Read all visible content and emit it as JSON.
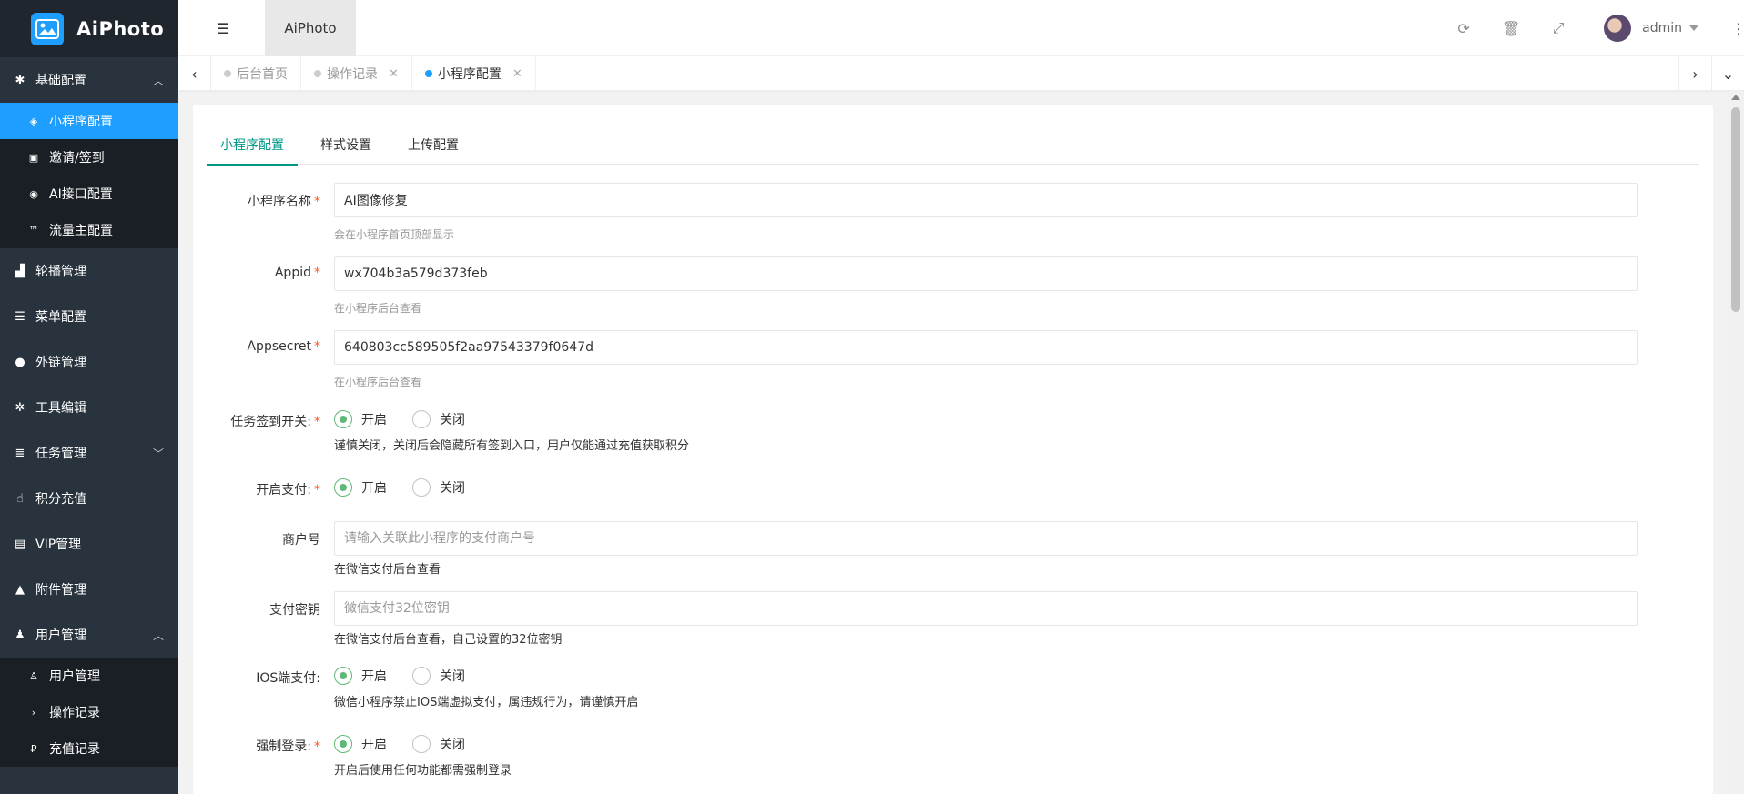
{
  "app": {
    "name": "AiPhoto",
    "header_tab": "AiPhoto"
  },
  "colors": {
    "accent": "#1e9fff",
    "tab_active": "#009688",
    "radio_checked": "#5fb878",
    "sidebar_bg": "#28333e"
  },
  "sidebar": {
    "groups": [
      {
        "label": "基础配置",
        "icon": "gear-icon",
        "expanded": true,
        "items": [
          {
            "label": "小程序配置",
            "icon": "eye-icon",
            "active": true
          },
          {
            "label": "邀请/签到",
            "icon": "contact-icon"
          },
          {
            "label": "AI接口配置",
            "icon": "chrome-icon"
          },
          {
            "label": "流量主配置",
            "icon": "trademark-icon"
          }
        ]
      },
      {
        "label": "轮播管理",
        "icon": "chart-icon"
      },
      {
        "label": "菜单配置",
        "icon": "menu-icon"
      },
      {
        "label": "外链管理",
        "icon": "android-icon"
      },
      {
        "label": "工具编辑",
        "icon": "cog-icon"
      },
      {
        "label": "任务管理",
        "icon": "list-icon",
        "collapsed_arrow": true
      },
      {
        "label": "积分充值",
        "icon": "hand-icon"
      },
      {
        "label": "VIP管理",
        "icon": "id-card-icon"
      },
      {
        "label": "附件管理",
        "icon": "upload-arrow-icon"
      },
      {
        "label": "用户管理",
        "icon": "user-icon",
        "expanded": true,
        "items": [
          {
            "label": "用户管理",
            "icon": "user-outline-icon"
          },
          {
            "label": "操作记录",
            "icon": "chevron-right-icon"
          },
          {
            "label": "充值记录",
            "icon": "paypal-icon"
          }
        ]
      }
    ]
  },
  "header": {
    "tools": [
      "refresh-icon",
      "trash-icon",
      "fullscreen-icon"
    ],
    "user": {
      "name": "admin"
    }
  },
  "page_tabs": [
    {
      "label": "后台首页",
      "closable": false
    },
    {
      "label": "操作记录",
      "closable": true
    },
    {
      "label": "小程序配置",
      "closable": true,
      "active": true
    }
  ],
  "content_tabs": [
    "小程序配置",
    "样式设置",
    "上传配置"
  ],
  "form": {
    "name": {
      "label": "小程序名称",
      "value": "AI图像修复",
      "hint": "会在小程序首页顶部显示"
    },
    "appid": {
      "label": "Appid",
      "value": "wx704b3a579d373feb",
      "hint": "在小程序后台查看"
    },
    "appsecret": {
      "label": "Appsecret",
      "value": "640803cc589505f2aa97543379f0647d",
      "hint": "在小程序后台查看"
    },
    "sign_switch": {
      "label": "任务签到开关:",
      "on": "开启",
      "off": "关闭",
      "value": "on",
      "hint": "谨慎关闭，关闭后会隐藏所有签到入口，用户仅能通过充值获取积分"
    },
    "pay_switch": {
      "label": "开启支付:",
      "on": "开启",
      "off": "关闭",
      "value": "on"
    },
    "merchant": {
      "label": "商户号",
      "value": "",
      "placeholder": "请输入关联此小程序的支付商户号",
      "hint": "在微信支付后台查看"
    },
    "pay_key": {
      "label": "支付密钥",
      "value": "",
      "placeholder": "微信支付32位密钥",
      "hint": "在微信支付后台查看，自己设置的32位密钥"
    },
    "ios_pay": {
      "label": "IOS端支付:",
      "on": "开启",
      "off": "关闭",
      "value": "on",
      "hint": "微信小程序禁止IOS端虚拟支付，属违规行为，请谨慎开启"
    },
    "force_login": {
      "label": "强制登录:",
      "on": "开启",
      "off": "关闭",
      "value": "on",
      "hint": "开启后使用任何功能都需强制登录"
    }
  }
}
